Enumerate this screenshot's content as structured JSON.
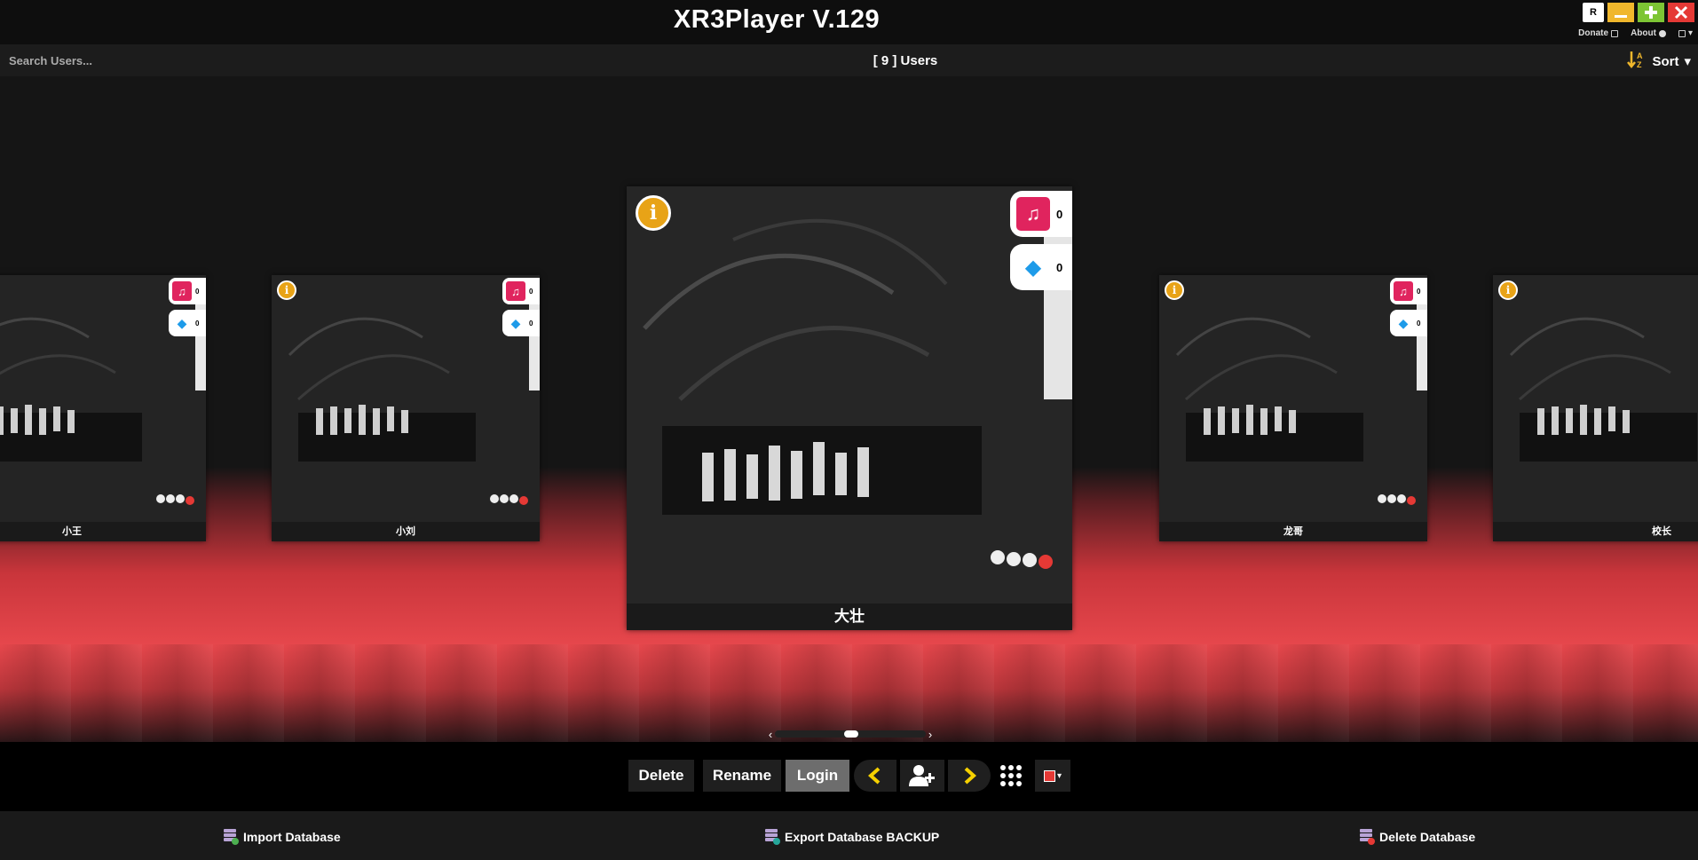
{
  "app": {
    "title": "XR3Player V.129"
  },
  "window_controls": {
    "r_label": "R"
  },
  "top_links": {
    "donate": "Donate",
    "about": "About"
  },
  "search": {
    "placeholder": "Search Users..."
  },
  "header": {
    "user_count": "[ 9 ] Users",
    "sort_label": "Sort"
  },
  "users": [
    {
      "name": "小王",
      "playlists": "0",
      "dropbox": "0"
    },
    {
      "name": "小刘",
      "playlists": "0",
      "dropbox": "0"
    },
    {
      "name": "大壮",
      "playlists": "0",
      "dropbox": "0"
    },
    {
      "name": "龙哥",
      "playlists": "0",
      "dropbox": "0"
    },
    {
      "name": "校长",
      "playlists": "0",
      "dropbox": "0"
    }
  ],
  "toolbar": {
    "delete": "Delete",
    "rename": "Rename",
    "login": "Login"
  },
  "footer": {
    "import": "Import Database",
    "export": "Export Database BACKUP",
    "delete_db": "Delete Database"
  },
  "colors": {
    "accent_red": "#e53935",
    "info_yellow": "#e8a317",
    "music_pink": "#e0245e",
    "dropbox_blue": "#1e9be9",
    "nav_yellow": "#f5d000"
  },
  "icons": [
    "info-icon",
    "music-playlist-icon",
    "dropbox-icon",
    "chevron-left-icon",
    "add-user-icon",
    "chevron-right-icon",
    "grid-icon",
    "color-picker-icon",
    "database-icon"
  ]
}
